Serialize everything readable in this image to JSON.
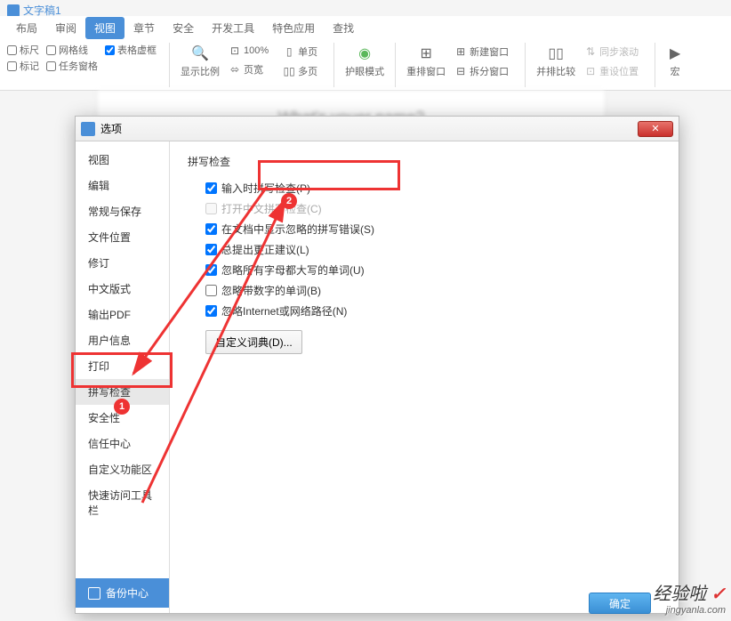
{
  "doc_tab": "文字稿1",
  "ribbon": {
    "tabs": [
      "布局",
      "审阅",
      "视图",
      "章节",
      "安全",
      "开发工具",
      "特色应用",
      "查找"
    ]
  },
  "toolbar": {
    "left_checks": [
      "标尺",
      "网格线",
      "表格虚框",
      "标记",
      "任务窗格"
    ],
    "zoom": {
      "pct": "100%",
      "label": "显示比例"
    },
    "page_width": "页宽",
    "single_page": "单页",
    "multi_page": "多页",
    "eye_mode": "护眼模式",
    "rearrange": "重排窗口",
    "new_window": "新建窗口",
    "split_window": "拆分窗口",
    "side_by_side": "并排比较",
    "sync_scroll": "同步滚动",
    "reset_pos": "重设位置",
    "macro": "宏"
  },
  "doc_bg_text": "What's vouer name?",
  "dialog": {
    "title": "选项",
    "sidebar": [
      "视图",
      "编辑",
      "常规与保存",
      "文件位置",
      "修订",
      "中文版式",
      "输出PDF",
      "用户信息",
      "打印",
      "拼写检查",
      "安全性",
      "信任中心",
      "自定义功能区",
      "快速访问工具栏"
    ],
    "backup": "备份中心",
    "section_title": "拼写检查",
    "checks": [
      {
        "label": "输入时拼写检查(P)",
        "checked": true,
        "disabled": false
      },
      {
        "label": "打开中文拼写检查(C)",
        "checked": false,
        "disabled": true
      },
      {
        "label": "在文档中显示忽略的拼写错误(S)",
        "checked": true,
        "disabled": false
      },
      {
        "label": "总提出更正建议(L)",
        "checked": true,
        "disabled": false
      },
      {
        "label": "忽略所有字母都大写的单词(U)",
        "checked": true,
        "disabled": false
      },
      {
        "label": "忽略带数字的单词(B)",
        "checked": false,
        "disabled": false
      },
      {
        "label": "忽略Internet或网络路径(N)",
        "checked": true,
        "disabled": false
      }
    ],
    "custom_dict": "自定义词典(D)...",
    "confirm": "确定"
  },
  "badges": {
    "b1": "1",
    "b2": "2"
  },
  "watermark": {
    "main": "经验啦",
    "sub": "jingyanla.com"
  }
}
